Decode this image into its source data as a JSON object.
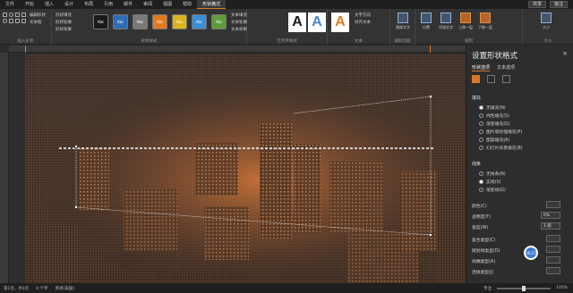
{
  "tabs": [
    {
      "label": "文件"
    },
    {
      "label": "开始"
    },
    {
      "label": "插入"
    },
    {
      "label": "设计"
    },
    {
      "label": "布局"
    },
    {
      "label": "引用"
    },
    {
      "label": "邮件"
    },
    {
      "label": "审阅"
    },
    {
      "label": "视图"
    },
    {
      "label": "帮助"
    },
    {
      "label": "形状格式"
    }
  ],
  "active_tab": "形状格式",
  "top_right": {
    "share": "共享",
    "comment": "批注"
  },
  "ribbon": {
    "insert_shapes_label": "插入形状",
    "edit_shape": "编辑形状",
    "text_box": "文本框",
    "shape_styles_label": "形状样式",
    "fill": "形状填充",
    "outline": "形状轮廓",
    "effects": "形状效果",
    "style_swatch_text": "Abc",
    "wordart_label": "艺术字样式",
    "wordart_letter": "A",
    "text_fill": "文本填充",
    "text_outline": "文本轮廓",
    "text_effects": "文本效果",
    "text_label": "文本",
    "text_direction": "文字方向",
    "align_text": "对齐文本",
    "accessibility_label": "辅助功能",
    "alt_text": "替换文字",
    "arrange_label": "排列",
    "position": "位置",
    "wrap": "环绕文字",
    "forward": "上移一层",
    "backward": "下移一层",
    "size_label": "大小",
    "size": "大小",
    "swatch_colors": [
      "#1a1a1a",
      "#2f6db5",
      "#7a7a7a",
      "#e07a1e",
      "#d9b51c",
      "#3b8fd4",
      "#5f9b3b"
    ],
    "wordart_colors": [
      "#1a1a1a",
      "#4a86c8",
      "#e07a1e"
    ]
  },
  "pane": {
    "title": "设置形状格式",
    "close": "×",
    "tabs": [
      "形状选项",
      "文本选项"
    ],
    "fill_section": "填充",
    "fill_options": [
      "无填充(N)",
      "纯色填充(S)",
      "渐变填充(G)",
      "图片或纹理填充(P)",
      "图案填充(A)",
      "幻灯片背景填充(B)"
    ],
    "line_section": "线条",
    "line_options": [
      "无线条(N)",
      "实线(S)",
      "渐变线(G)"
    ],
    "props": [
      {
        "label": "颜色(C)",
        "value": ""
      },
      {
        "label": "透明度(T)",
        "value": "0%"
      },
      {
        "label": "宽度(W)",
        "value": "1 磅"
      },
      {
        "label": "复合类型(C)",
        "value": ""
      },
      {
        "label": "短划线类型(D)",
        "value": ""
      },
      {
        "label": "线端类型(A)",
        "value": ""
      },
      {
        "label": "连接类型(J)",
        "value": ""
      }
    ],
    "fab_label": "00:27"
  },
  "status": {
    "page": "第1页，共1页",
    "words": "0 个字",
    "lang": "英语(美国)",
    "focus": "专注",
    "zoom": "100%",
    "zoom_level": 0.5
  }
}
